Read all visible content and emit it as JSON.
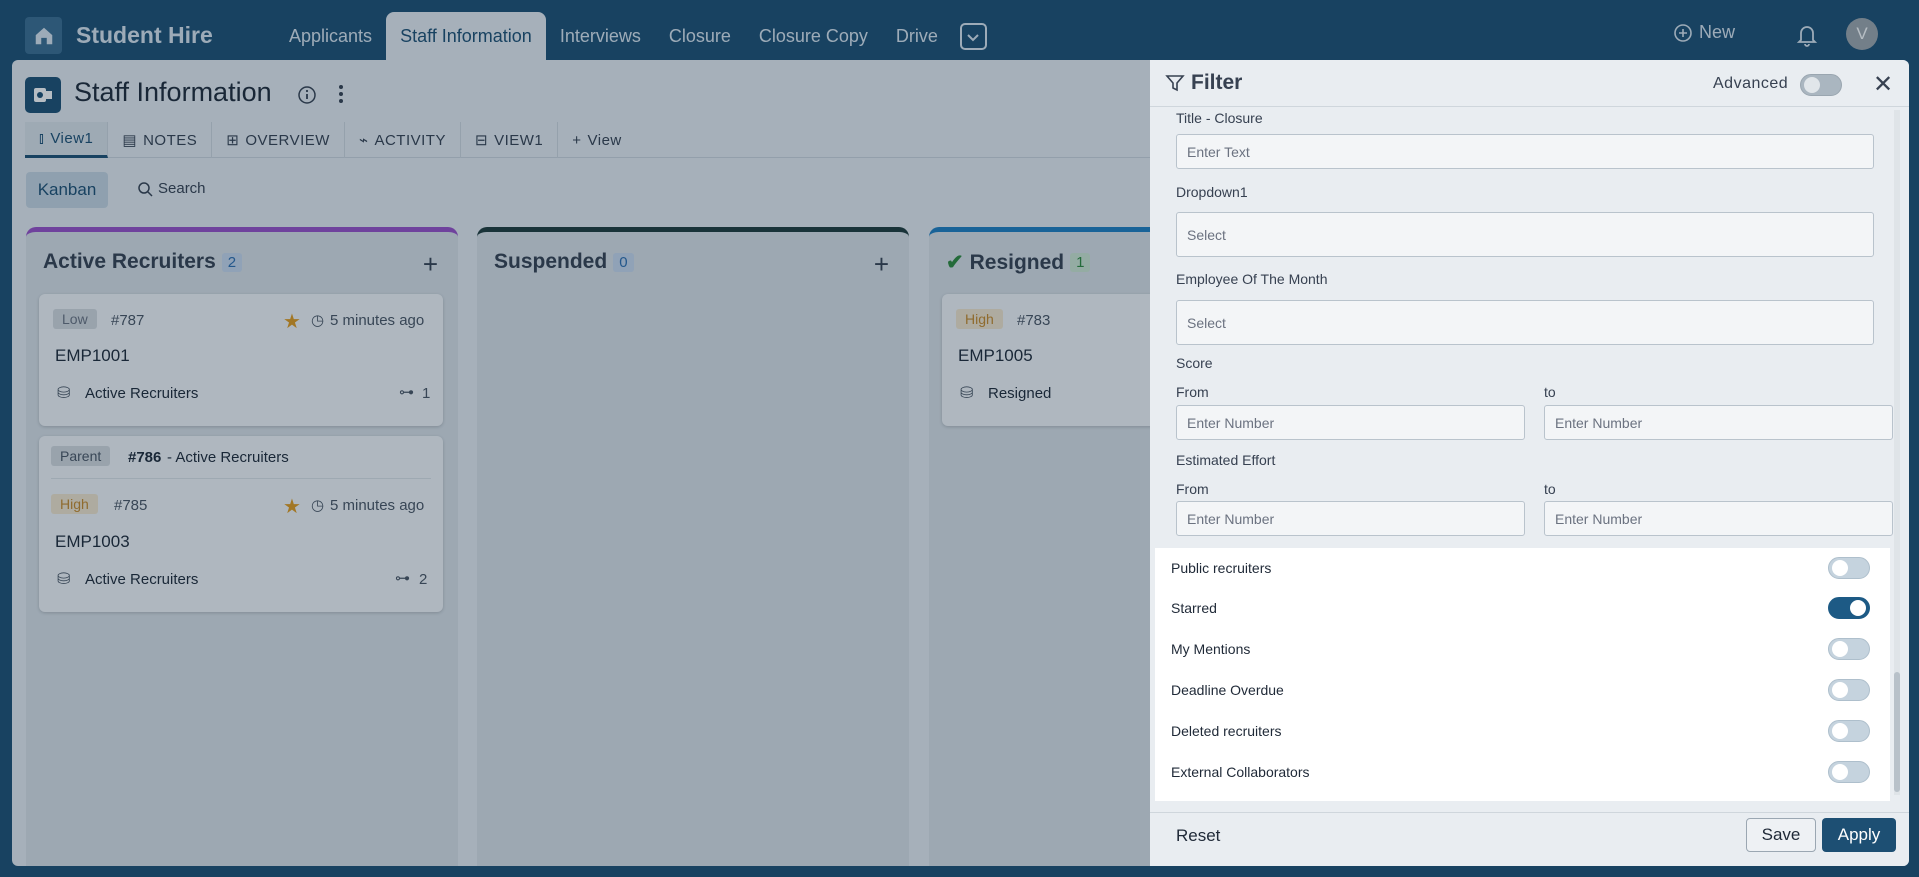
{
  "app": {
    "title": "Student Hire"
  },
  "nav": {
    "items": [
      "Applicants",
      "Staff Information",
      "Interviews",
      "Closure",
      "Closure Copy",
      "Drive"
    ],
    "active": "Staff Information",
    "new_label": "New",
    "avatar_letter": "V"
  },
  "page": {
    "title": "Staff Information",
    "tabs": [
      "View1",
      "NOTES",
      "OVERVIEW",
      "ACTIVITY",
      "VIEW1",
      "View"
    ],
    "kanban_label": "Kanban",
    "search_label": "Search"
  },
  "columns": [
    {
      "title": "Active Recruiters",
      "count": "2",
      "color": "#9a4fc9",
      "count_bg": "#c9d8ee",
      "count_fg": "#2f6fb0"
    },
    {
      "title": "Suspended",
      "count": "0",
      "color": "#1f3a3a",
      "count_bg": "#c9d8ee",
      "count_fg": "#2f6fb0"
    },
    {
      "title": "Resigned",
      "count": "1",
      "color": "#1f7fc2",
      "count_bg": "#cfe7d2",
      "count_fg": "#2e8a3c"
    }
  ],
  "cards": [
    {
      "priority": "Low",
      "num": "#787",
      "time": "5 minutes ago",
      "name": "EMP1001",
      "status": "Active Recruiters",
      "sub": "1"
    },
    {
      "parent_label": "Parent",
      "parent_num": "#786",
      "parent_text": "- Active Recruiters",
      "priority": "High",
      "num": "#785",
      "time": "5 minutes ago",
      "name": "EMP1003",
      "status": "Active Recruiters",
      "sub": "2"
    },
    {
      "priority": "High",
      "num": "#783",
      "name": "EMP1005",
      "status": "Resigned"
    }
  ],
  "filter": {
    "title": "Filter",
    "advanced_label": "Advanced",
    "fields": {
      "title_closure": {
        "label": "Title - Closure",
        "placeholder": "Enter Text"
      },
      "dropdown1": {
        "label": "Dropdown1",
        "placeholder": "Select"
      },
      "employee_month": {
        "label": "Employee Of The Month",
        "placeholder": "Select"
      },
      "score": {
        "label": "Score",
        "from": "From",
        "to": "to",
        "placeholder": "Enter Number"
      },
      "estimated_effort": {
        "label": "Estimated Effort",
        "from": "From",
        "to": "to",
        "placeholder": "Enter Number"
      }
    },
    "switches": [
      {
        "label": "Public recruiters",
        "on": false
      },
      {
        "label": "Starred",
        "on": true
      },
      {
        "label": "My Mentions",
        "on": false
      },
      {
        "label": "Deadline Overdue",
        "on": false
      },
      {
        "label": "Deleted recruiters",
        "on": false
      },
      {
        "label": "External Collaborators",
        "on": false
      }
    ],
    "reset_label": "Reset",
    "save_label": "Save",
    "apply_label": "Apply"
  }
}
